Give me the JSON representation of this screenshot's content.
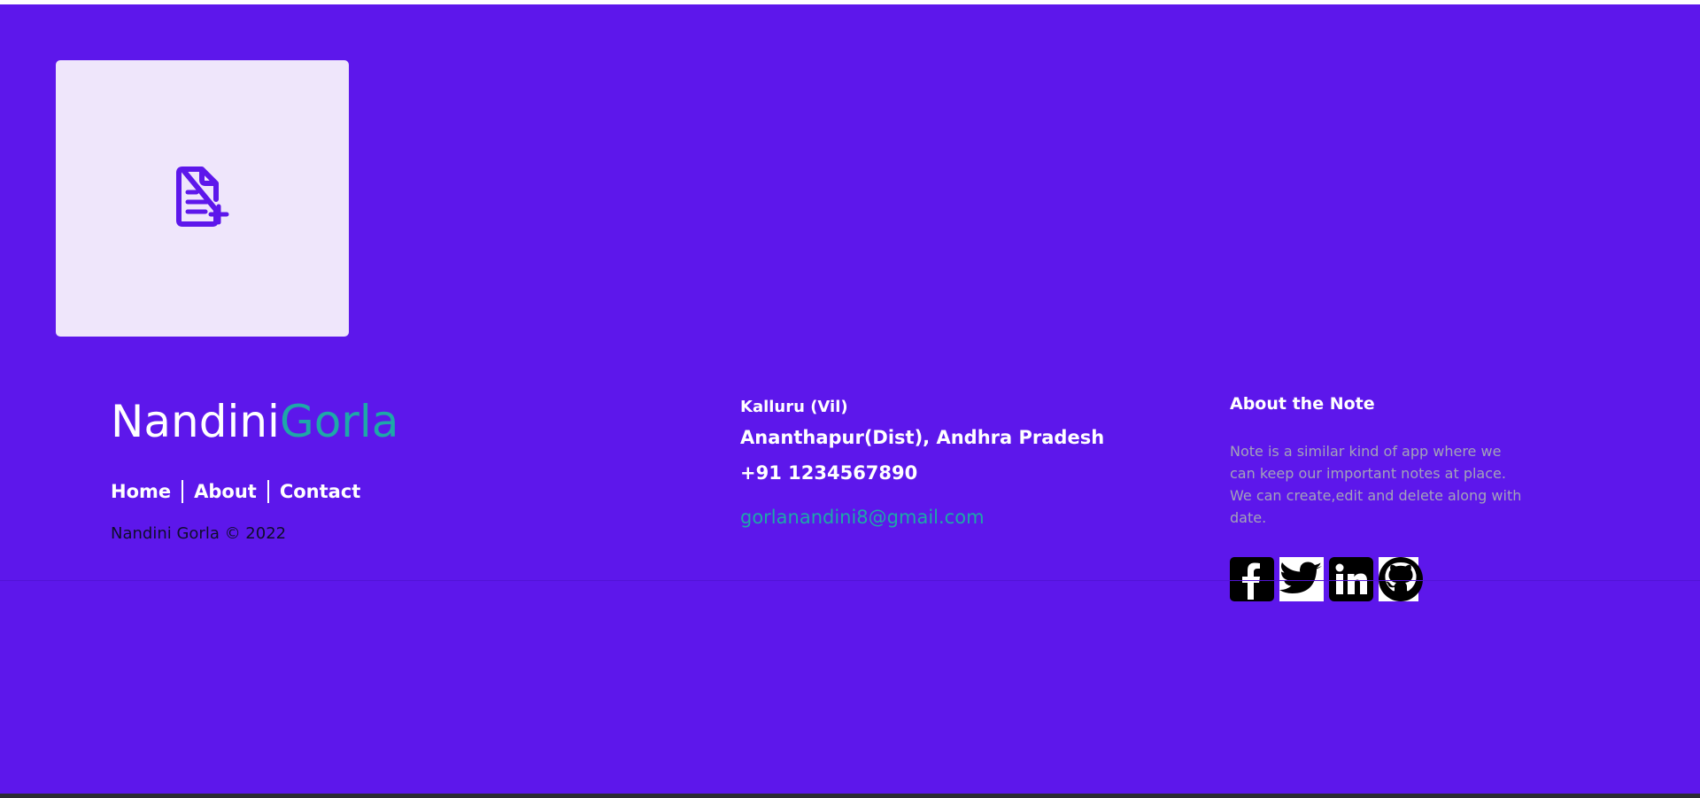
{
  "add_note": {
    "icon": "document-plus-icon",
    "accent": "#5d17eb",
    "card_bg": "#efe6fb"
  },
  "footer": {
    "brand": {
      "first": "Nandini",
      "last": "Gorla",
      "last_color": "#1ea8a8"
    },
    "nav": [
      {
        "label": "Home"
      },
      {
        "label": "About"
      },
      {
        "label": "Contact"
      }
    ],
    "copyright": "Nandini Gorla © 2022",
    "address": {
      "line1": "Kalluru (Vil)",
      "line2": "Ananthapur(Dist), Andhra Pradesh",
      "phone": "+91 1234567890",
      "email": "gorlanandini8@gmail.com"
    },
    "about": {
      "heading": "About the Note",
      "text": "Note is a similar kind of app where we can keep our important notes at place. We can create,edit and delete along with date."
    },
    "socials": [
      {
        "icon": "facebook-icon"
      },
      {
        "icon": "twitter-icon"
      },
      {
        "icon": "linkedin-icon"
      },
      {
        "icon": "github-icon"
      }
    ]
  },
  "colors": {
    "background": "#5d17eb",
    "accent_teal": "#1ea8a8",
    "muted_text": "#a3a3b8"
  }
}
